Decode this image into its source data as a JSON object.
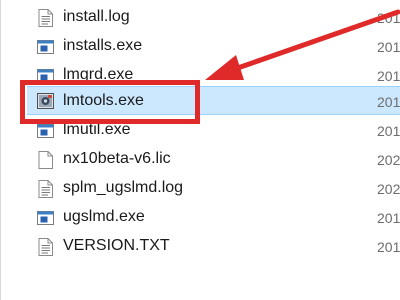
{
  "files": [
    {
      "name": "install.log",
      "date": "201",
      "icon": "text-file-icon"
    },
    {
      "name": "installs.exe",
      "date": "201",
      "icon": "exe-file-icon"
    },
    {
      "name": "lmgrd.exe",
      "date": "201",
      "icon": "exe-file-icon"
    },
    {
      "name": "lmtools.exe",
      "date": "201",
      "icon": "lmtools-app-icon",
      "selected": true
    },
    {
      "name": "lmutil.exe",
      "date": "201",
      "icon": "exe-file-icon"
    },
    {
      "name": "nx10beta-v6.lic",
      "date": "202",
      "icon": "blank-file-icon"
    },
    {
      "name": "splm_ugslmd.log",
      "date": "202",
      "icon": "text-file-icon"
    },
    {
      "name": "ugslmd.exe",
      "date": "201",
      "icon": "exe-file-icon"
    },
    {
      "name": "VERSION.TXT",
      "date": "201",
      "icon": "text-file-icon"
    }
  ],
  "colors": {
    "selection_bg": "#cce8ff",
    "annotation_red": "#e02a2a"
  }
}
